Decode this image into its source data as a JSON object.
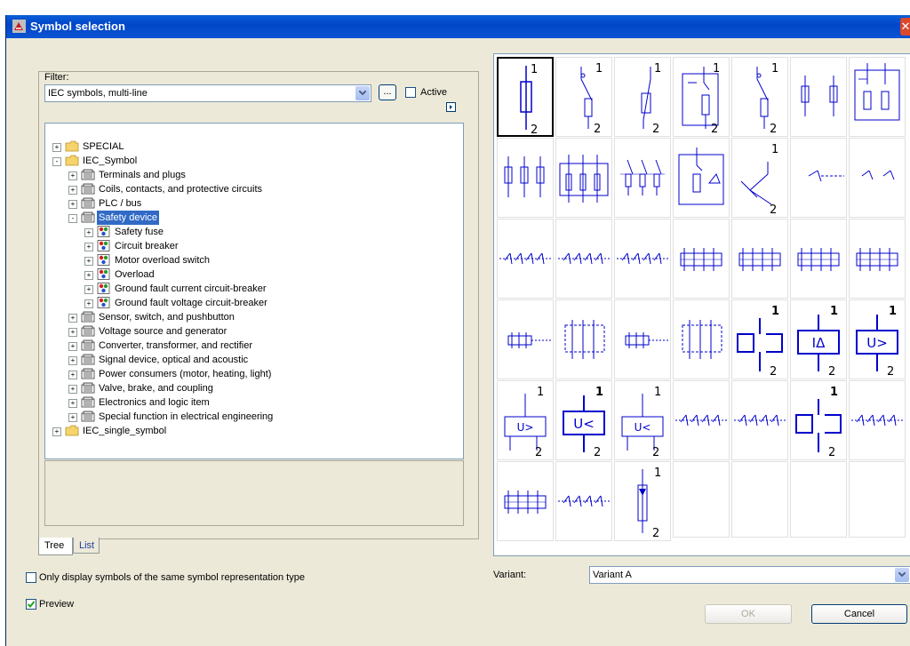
{
  "window": {
    "title": "Symbol selection"
  },
  "filter": {
    "label": "Filter:",
    "value": "IEC symbols, multi-line",
    "dots_label": "...",
    "active_label": "Active"
  },
  "tree": {
    "items": [
      {
        "label": "SPECIAL",
        "level": 0,
        "icon": "folder-icon",
        "expander": "+"
      },
      {
        "label": "IEC_Symbol",
        "level": 0,
        "icon": "folder-open-icon",
        "expander": "-"
      },
      {
        "label": "Terminals and plugs",
        "level": 1,
        "icon": "library-icon",
        "expander": "+"
      },
      {
        "label": "Coils, contacts, and protective circuits",
        "level": 1,
        "icon": "library-icon",
        "expander": "+"
      },
      {
        "label": "PLC / bus",
        "level": 1,
        "icon": "library-icon",
        "expander": "+"
      },
      {
        "label": "Safety device",
        "level": 1,
        "icon": "library-icon",
        "expander": "-",
        "selected": true
      },
      {
        "label": "Safety fuse",
        "level": 2,
        "icon": "symbol-group-icon",
        "expander": "+"
      },
      {
        "label": "Circuit breaker",
        "level": 2,
        "icon": "symbol-group-icon",
        "expander": "+"
      },
      {
        "label": "Motor overload switch",
        "level": 2,
        "icon": "symbol-group-icon",
        "expander": "+"
      },
      {
        "label": "Overload",
        "level": 2,
        "icon": "symbol-group-icon",
        "expander": "+"
      },
      {
        "label": "Ground fault current circuit-breaker",
        "level": 2,
        "icon": "symbol-group-icon",
        "expander": "+"
      },
      {
        "label": "Ground fault voltage circuit-breaker",
        "level": 2,
        "icon": "symbol-group-icon",
        "expander": "+"
      },
      {
        "label": "Sensor, switch, and pushbutton",
        "level": 1,
        "icon": "library-icon",
        "expander": "+"
      },
      {
        "label": "Voltage source and generator",
        "level": 1,
        "icon": "library-icon",
        "expander": "+"
      },
      {
        "label": "Converter, transformer, and rectifier",
        "level": 1,
        "icon": "library-icon",
        "expander": "+"
      },
      {
        "label": "Signal device, optical and acoustic",
        "level": 1,
        "icon": "library-icon",
        "expander": "+"
      },
      {
        "label": "Power consumers (motor, heating, light)",
        "level": 1,
        "icon": "library-icon",
        "expander": "+"
      },
      {
        "label": "Valve, brake, and coupling",
        "level": 1,
        "icon": "library-icon",
        "expander": "+"
      },
      {
        "label": "Electronics and logic item",
        "level": 1,
        "icon": "library-icon",
        "expander": "+"
      },
      {
        "label": "Special function in electrical engineering",
        "level": 1,
        "icon": "library-icon",
        "expander": "+"
      },
      {
        "label": "IEC_single_symbol",
        "level": 0,
        "icon": "folder-icon",
        "expander": "+"
      }
    ]
  },
  "tabs": [
    {
      "label": "Tree",
      "active": true
    },
    {
      "label": "List",
      "active": false
    }
  ],
  "options": {
    "same_type_label": "Only display symbols of the same symbol representation type",
    "same_type_checked": false,
    "preview_label": "Preview",
    "preview_checked": true
  },
  "symbols": [
    {
      "kind": "fuse",
      "t1": "1",
      "t2": "2"
    },
    {
      "kind": "switch-fuse",
      "t1": "1",
      "t2": "2"
    },
    {
      "kind": "fuse-disc",
      "t1": "1",
      "t2": "2"
    },
    {
      "kind": "box-fuse",
      "t1": "1",
      "t2": "2"
    },
    {
      "kind": "switch-fuse",
      "t1": "1",
      "t2": "2"
    },
    {
      "kind": "double-fuse",
      "t1": "",
      "t2": ""
    },
    {
      "kind": "box-double",
      "t1": "",
      "t2": ""
    },
    {
      "kind": "triple-fuse",
      "t1": "",
      "t2": ""
    },
    {
      "kind": "box-triple",
      "t1": "",
      "t2": ""
    },
    {
      "kind": "triple-switch",
      "t1": "",
      "t2": ""
    },
    {
      "kind": "box-breaker",
      "t1": "",
      "t2": ""
    },
    {
      "kind": "breaker",
      "t1": "1",
      "t2": "2"
    },
    {
      "kind": "breaker-dash",
      "t1": "",
      "t2": ""
    },
    {
      "kind": "breaker-pair",
      "t1": "",
      "t2": ""
    },
    {
      "kind": "multi-contact",
      "t1": "",
      "t2": ""
    },
    {
      "kind": "multi-contact",
      "t1": "",
      "t2": ""
    },
    {
      "kind": "multi-contact",
      "t1": "",
      "t2": ""
    },
    {
      "kind": "multi-box",
      "t1": "",
      "t2": ""
    },
    {
      "kind": "multi-box",
      "t1": "",
      "t2": ""
    },
    {
      "kind": "multi-box",
      "t1": "",
      "t2": ""
    },
    {
      "kind": "multi-box",
      "t1": "",
      "t2": ""
    },
    {
      "kind": "small-box",
      "t1": "",
      "t2": ""
    },
    {
      "kind": "box-dashed",
      "t1": "",
      "t2": ""
    },
    {
      "kind": "small-box",
      "t1": "",
      "t2": ""
    },
    {
      "kind": "box-dashed",
      "t1": "",
      "t2": ""
    },
    {
      "kind": "overload",
      "t1": "1",
      "t2": "2"
    },
    {
      "kind": "relay-text",
      "t1": "1",
      "t2": "2",
      "text": "IΔ"
    },
    {
      "kind": "relay-text",
      "t1": "1",
      "t2": "2",
      "text": "U>"
    },
    {
      "kind": "relay-text-thin",
      "t1": "1",
      "t2": "2",
      "text": "U>"
    },
    {
      "kind": "relay-text-bold",
      "t1": "1",
      "t2": "2",
      "text": "U<"
    },
    {
      "kind": "relay-text-thin",
      "t1": "1",
      "t2": "2",
      "text": "U<"
    },
    {
      "kind": "multi-contact",
      "t1": "",
      "t2": ""
    },
    {
      "kind": "multi-contact",
      "t1": "",
      "t2": ""
    },
    {
      "kind": "overload",
      "t1": "1",
      "t2": "2"
    },
    {
      "kind": "multi-contact",
      "t1": "",
      "t2": ""
    },
    {
      "kind": "multi-box",
      "t1": "",
      "t2": ""
    },
    {
      "kind": "multi-contact",
      "t1": "",
      "t2": ""
    },
    {
      "kind": "fuse-arrow",
      "t1": "1",
      "t2": "2"
    }
  ],
  "variant": {
    "label": "Variant:",
    "value": "Variant A"
  },
  "buttons": {
    "ok": "OK",
    "cancel": "Cancel"
  },
  "colors": {
    "symbol": "#0000cc",
    "selection": "#316ac5",
    "title_bar": "#0046c8"
  }
}
